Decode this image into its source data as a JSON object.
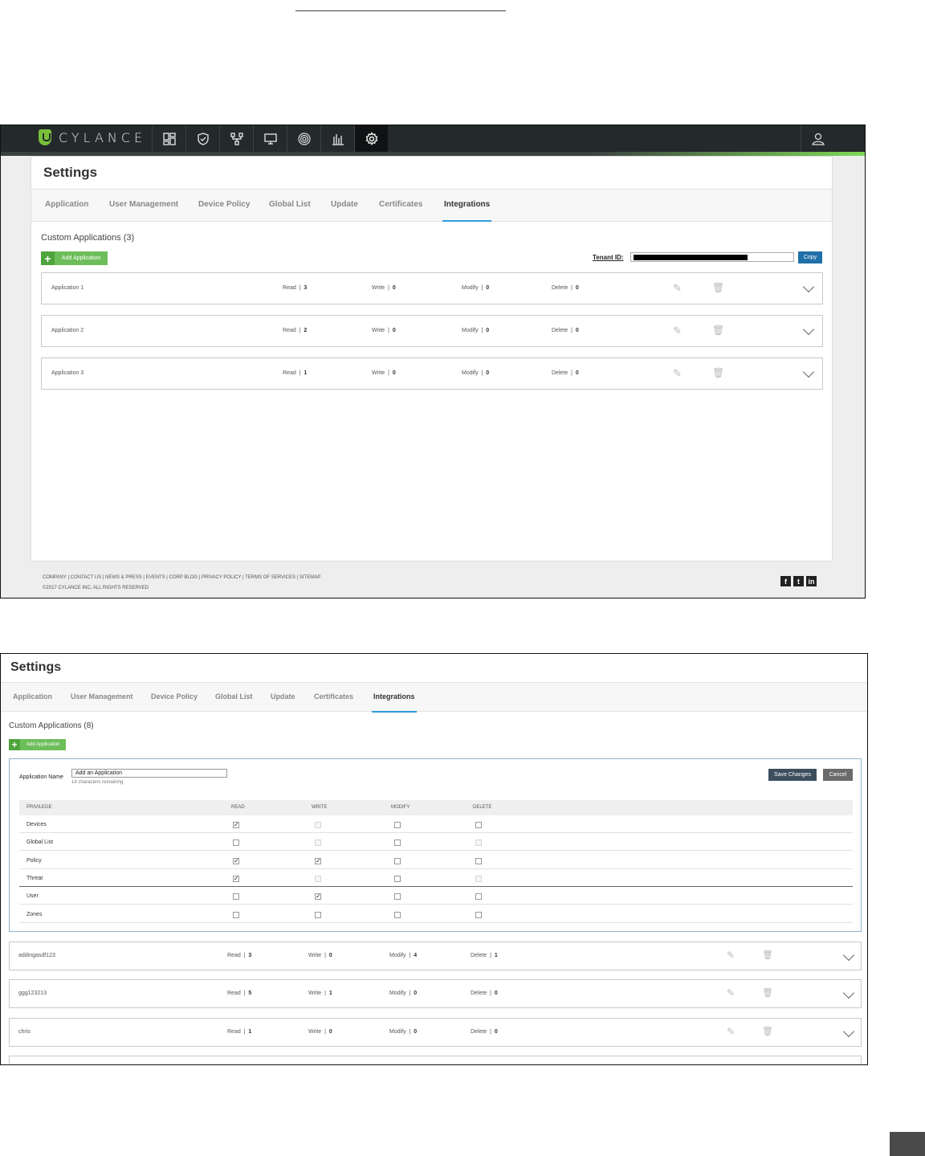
{
  "shot1": {
    "brand": "CYLANCE",
    "nav_icons": [
      "dashboard-icon",
      "shield-icon",
      "network-icon",
      "monitor-icon",
      "fingerprint-icon",
      "reports-icon",
      "gear-icon"
    ],
    "page_title": "Settings",
    "tabs": [
      "Application",
      "User Management",
      "Device Policy",
      "Global List",
      "Update",
      "Certificates",
      "Integrations"
    ],
    "active_tab": "Integrations",
    "section_title": "Custom Applications (3)",
    "add_button": "Add Application",
    "tenant_label": "Tenant ID:",
    "copy_button": "Copy",
    "applications": [
      {
        "name": "Application 1",
        "read": "3",
        "write": "0",
        "modify": "0",
        "delete": "0"
      },
      {
        "name": "Application 2",
        "read": "2",
        "write": "0",
        "modify": "0",
        "delete": "0"
      },
      {
        "name": "Application 3",
        "read": "1",
        "write": "0",
        "modify": "0",
        "delete": "0"
      }
    ],
    "footer_links": "COMPANY  |  CONTACT US  |  NEWS & PRESS  |  EVENTS  |  CORP BLOG  |  PRIVACY POLICY  |  TERMS OF SERVICES  |  SITEMAP",
    "copyright": "©2017 CYLANCE INC, ALL RIGHTS RESERVED",
    "social": [
      "f",
      "t",
      "in"
    ]
  },
  "shot2": {
    "page_title": "Settings",
    "tabs": [
      "Application",
      "User Management",
      "Device Policy",
      "Global List",
      "Update",
      "Certificates",
      "Integrations"
    ],
    "active_tab": "Integrations",
    "section_title": "Custom Applications (8)",
    "add_button": "Add Application",
    "form": {
      "name_label": "Application Name",
      "name_value": "Add an Application",
      "remaining": "14 characters remaining",
      "save_button": "Save Changes",
      "cancel_button": "Cancel",
      "columns": [
        "PRIVILEGE",
        "READ",
        "WRITE",
        "MODIFY",
        "DELETE"
      ],
      "privileges": [
        {
          "name": "Devices",
          "read": true,
          "write": false,
          "modify": false,
          "delete": false,
          "write_disabled": true,
          "delete_disabled": false
        },
        {
          "name": "Global List",
          "read": false,
          "write": false,
          "modify": false,
          "delete": false,
          "write_disabled": true,
          "delete_disabled": true
        },
        {
          "name": "Policy",
          "read": true,
          "write": true,
          "modify": false,
          "delete": false,
          "write_disabled": false,
          "delete_disabled": false
        },
        {
          "name": "Threat",
          "read": true,
          "write": false,
          "modify": false,
          "delete": false,
          "write_disabled": true,
          "delete_disabled": true
        },
        {
          "name": "User",
          "read": false,
          "write": true,
          "modify": false,
          "delete": false,
          "write_disabled": false,
          "delete_disabled": false
        },
        {
          "name": "Zones",
          "read": false,
          "write": false,
          "modify": false,
          "delete": false,
          "write_disabled": false,
          "delete_disabled": false
        }
      ]
    },
    "applications": [
      {
        "name": "addingasdf123",
        "read": "3",
        "write": "0",
        "modify": "4",
        "delete": "1"
      },
      {
        "name": "ggg123213",
        "read": "5",
        "write": "1",
        "modify": "0",
        "delete": "0"
      },
      {
        "name": "chris",
        "read": "1",
        "write": "0",
        "modify": "0",
        "delete": "0"
      }
    ]
  },
  "labels": {
    "read": "Read",
    "write": "Write",
    "modify": "Modify",
    "delete": "Delete"
  },
  "colors": {
    "accent_blue": "#2ea0d8",
    "add_green": "#6dbe5b",
    "copy_blue": "#1f6fa8",
    "save_dark": "#3d4f5e",
    "cancel_gray": "#6b6b6b",
    "nav_dark": "#24292b",
    "brand_green": "#78c03a"
  }
}
